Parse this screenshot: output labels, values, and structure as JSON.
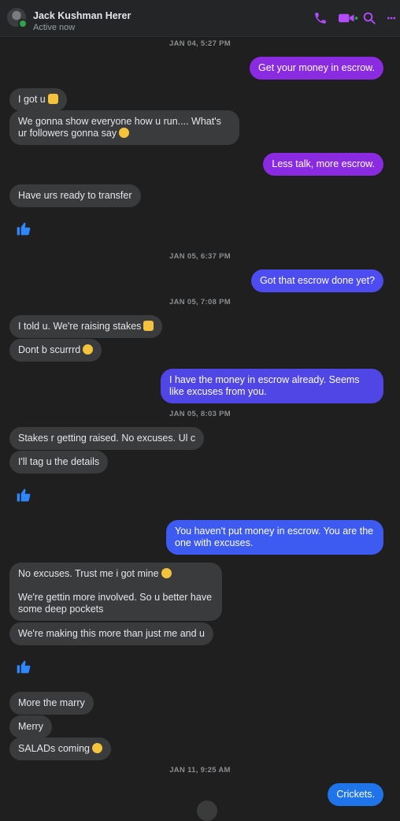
{
  "header": {
    "contact_name": "Jack Kushman Herer",
    "status": "Active now",
    "icons": [
      "phone-icon",
      "video-icon",
      "search-icon",
      "more-icon"
    ]
  },
  "timestamps": [
    "JAN 04, 5:27 PM",
    "JAN 05, 6:37 PM",
    "JAN 05, 7:08 PM",
    "JAN 05, 8:03 PM",
    "JAN 11, 9:25 AM"
  ],
  "messages": [
    {
      "text": "Get your money in escrow."
    },
    {
      "text": "I got u",
      "emoji": "thumbs-up"
    },
    {
      "text": "We gonna show everyone how u run.... What's ur followers gonna say",
      "emoji": "grimace"
    },
    {
      "text": "Less talk, more escrow."
    },
    {
      "text": "Have urs ready to transfer"
    },
    {
      "text": "Got that escrow done yet?"
    },
    {
      "text": "I told u. We're raising stakes",
      "emoji": "thumbs-up"
    },
    {
      "text": "Dont b scurrrd",
      "emoji": "smirk"
    },
    {
      "text": "I have the money in escrow already. Seems like excuses from you."
    },
    {
      "text": "Stakes r getting raised. No excuses. Ul c"
    },
    {
      "text": "I'll tag u the details"
    },
    {
      "text": "You haven't put money in escrow. You are the one with excuses."
    },
    {
      "text": "No excuses. Trust me i got mine",
      "emoji": "laughing"
    },
    {
      "text": "We're gettin more involved. So u better have some deep pockets"
    },
    {
      "text": "We're making this more than just me and u"
    },
    {
      "text": "More the marry"
    },
    {
      "text": "Merry"
    },
    {
      "text": "SALADs coming",
      "emoji": "smirk"
    },
    {
      "text": "Crickets."
    }
  ],
  "colors": {
    "background": "#1f1f1f",
    "incoming_bubble": "#3a3b3c",
    "outgoing_purple": "#8a2be2",
    "outgoing_blue": "#1e74e8",
    "accent_icons": "#b44bff",
    "like_blue": "#2d88ff"
  }
}
